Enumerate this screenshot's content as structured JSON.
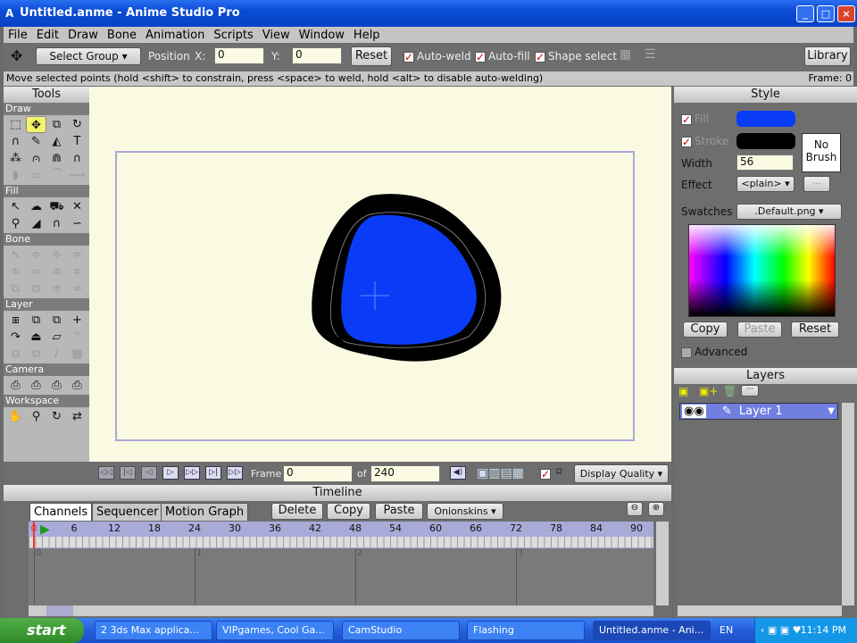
{
  "window": {
    "title": "Untitled.anme - Anime Studio Pro",
    "app_icon": "anime-studio-icon",
    "controls": [
      "_",
      "□",
      "×"
    ]
  },
  "menu": [
    "File",
    "Edit",
    "Draw",
    "Bone",
    "Animation",
    "Scripts",
    "View",
    "Window",
    "Help"
  ],
  "toolbar": {
    "tool_icon": "move-arrows-icon",
    "group_select": "Select Group",
    "position_label": "Position",
    "x_label": "X:",
    "x_value": "0",
    "y_label": "Y:",
    "y_value": "0",
    "reset": "Reset",
    "auto_weld": "Auto-weld",
    "auto_fill": "Auto-fill",
    "shape_select": "Shape select",
    "auto_weld_checked": true,
    "auto_fill_checked": true,
    "shape_select_checked": true,
    "library": "Library"
  },
  "status": {
    "message": "Move selected points (hold <shift> to constrain, press <space> to weld, hold <alt> to disable auto-welding)",
    "frame": "Frame: 0"
  },
  "tools": {
    "title": "Tools",
    "sections": [
      {
        "name": "Draw",
        "icons": [
          [
            "select-points-icon",
            "⬚",
            ""
          ],
          [
            "translate-points-icon",
            "✥",
            "sel"
          ],
          [
            "scale-points-icon",
            "⧉",
            ""
          ],
          [
            "rotate-points-icon",
            "↻",
            ""
          ],
          [
            "add-point-icon",
            "∩",
            ""
          ],
          [
            "freehand-icon",
            "✎",
            ""
          ],
          [
            "draw-shape-icon",
            "◭",
            ""
          ],
          [
            "text-icon",
            "T",
            ""
          ],
          [
            "scatter-brush-icon",
            "⁂",
            ""
          ],
          [
            "delete-edge-icon",
            "⩀",
            ""
          ],
          [
            "curvature-icon",
            "⋒",
            ""
          ],
          [
            "magnet-icon",
            "∩",
            ""
          ],
          [
            "perspective-icon",
            "◗",
            "dis"
          ],
          [
            "shear-icon",
            "▱",
            "dis"
          ],
          [
            "bend-icon",
            "⌒",
            "dis"
          ],
          [
            "noise-icon",
            "⟶",
            "dis"
          ]
        ]
      },
      {
        "name": "Fill",
        "icons": [
          [
            "select-shape-icon",
            "↖",
            ""
          ],
          [
            "create-shape-icon",
            "☁",
            ""
          ],
          [
            "paint-bucket-icon",
            "⛟",
            ""
          ],
          [
            "delete-shape-icon",
            "✕",
            ""
          ],
          [
            "eyedropper-icon",
            "⚲",
            ""
          ],
          [
            "line-width-icon",
            "◢",
            ""
          ],
          [
            "hide-edge-icon",
            "∩",
            ""
          ],
          [
            "stroke-exposure-icon",
            "∽",
            ""
          ]
        ]
      },
      {
        "name": "Bone",
        "icons": [
          [
            "select-bone-icon",
            "↖",
            "dis"
          ],
          [
            "translate-bone-icon",
            "≑",
            "dis"
          ],
          [
            "scale-bone-icon",
            "≑",
            "dis"
          ],
          [
            "rotate-bone-icon",
            "≑",
            "dis"
          ],
          [
            "add-bone-icon",
            "≑",
            "dis"
          ],
          [
            "reparent-bone-icon",
            "∞",
            "dis"
          ],
          [
            "bone-strength-icon",
            "≑",
            "dis"
          ],
          [
            "manipulate-bones-icon",
            "≑",
            "dis"
          ],
          [
            "bind-layer-icon",
            "⧉",
            "dis"
          ],
          [
            "bind-points-icon",
            "⧉",
            "dis"
          ],
          [
            "offset-bone-icon",
            "≑",
            "dis"
          ],
          [
            "bone-other-icon",
            "∞",
            "dis"
          ]
        ]
      },
      {
        "name": "Layer",
        "icons": [
          [
            "set-origin-icon",
            "⧆",
            ""
          ],
          [
            "translate-layer-icon",
            "⧉",
            ""
          ],
          [
            "scale-layer-icon",
            "⧉",
            ""
          ],
          [
            "rotate-layer-z-icon",
            "+",
            ""
          ],
          [
            "rotate-layer-xy-icon",
            "↷",
            ""
          ],
          [
            "shear-layer-icon",
            "⏏",
            ""
          ],
          [
            "flip-layer-icon",
            "▱",
            ""
          ],
          [
            "switch-layer-icon",
            "⚚",
            "dis"
          ],
          [
            "particle-icon",
            "⧉",
            "dis"
          ],
          [
            "layer-misc-icon",
            "⧉",
            "dis"
          ],
          [
            "eyedropper-layer-icon",
            "/",
            "dis"
          ],
          [
            "film-icon",
            "▦",
            "dis"
          ]
        ]
      },
      {
        "name": "Camera",
        "icons": [
          [
            "track-camera-icon",
            "⎙",
            ""
          ],
          [
            "zoom-camera-icon",
            "⎙",
            ""
          ],
          [
            "roll-camera-icon",
            "⎙",
            ""
          ],
          [
            "pan-tilt-camera-icon",
            "⎙",
            ""
          ]
        ]
      },
      {
        "name": "Workspace",
        "icons": [
          [
            "hand-icon",
            "✋",
            ""
          ],
          [
            "zoom-icon",
            "⚲",
            ""
          ],
          [
            "rotate-workspace-icon",
            "↻",
            ""
          ],
          [
            "orbit-workspace-icon",
            "⇄",
            ""
          ]
        ]
      }
    ]
  },
  "canvas": {
    "fill_color": "#0a3cf8",
    "stroke_color": "#000000"
  },
  "playback": {
    "buttons": [
      "rewind-icon",
      "step-back-start-icon",
      "step-back-icon",
      "play-icon",
      "step-forward-icon",
      "step-forward-end-icon",
      "fast-forward-icon"
    ],
    "frame_label": "Frame",
    "frame_value": "0",
    "of_label": "of",
    "total_frames": "240",
    "display_quality": "Display Quality"
  },
  "timeline": {
    "title": "Timeline",
    "tabs": [
      "Channels",
      "Sequencer",
      "Motion Graph"
    ],
    "active_tab": "Channels",
    "buttons": [
      "Delete",
      "Copy",
      "Paste"
    ],
    "onionskins": "Onionskins",
    "ruler_ticks": [
      "0",
      "6",
      "12",
      "18",
      "24",
      "30",
      "36",
      "42",
      "48",
      "54",
      "60",
      "66",
      "72",
      "78",
      "84",
      "90"
    ],
    "seconds": [
      "0",
      "1",
      "2",
      "3"
    ]
  },
  "style": {
    "title": "Style",
    "fill_label": "Fill",
    "stroke_label": "Stroke",
    "fill_color": "#0a3cf8",
    "stroke_color": "#000000",
    "no_brush": [
      "No",
      "Brush"
    ],
    "width_label": "Width",
    "width_value": "56",
    "effect_label": "Effect",
    "effect_value": "<plain>",
    "more": "...",
    "swatches_label": "Swatches",
    "swatches_value": ".Default.png",
    "copy": "Copy",
    "paste": "Paste",
    "reset": "Reset",
    "advanced": "Advanced"
  },
  "layers": {
    "title": "Layers",
    "items": [
      {
        "name": "Layer 1"
      }
    ]
  },
  "taskbar": {
    "start": "start",
    "tasks": [
      "2 3ds Max applica...",
      "VIPgames, Cool Ga...",
      "CamStudio",
      "Flashing",
      "Untitled.anme - Ani..."
    ],
    "lang": "EN",
    "time": "11:14 PM"
  }
}
